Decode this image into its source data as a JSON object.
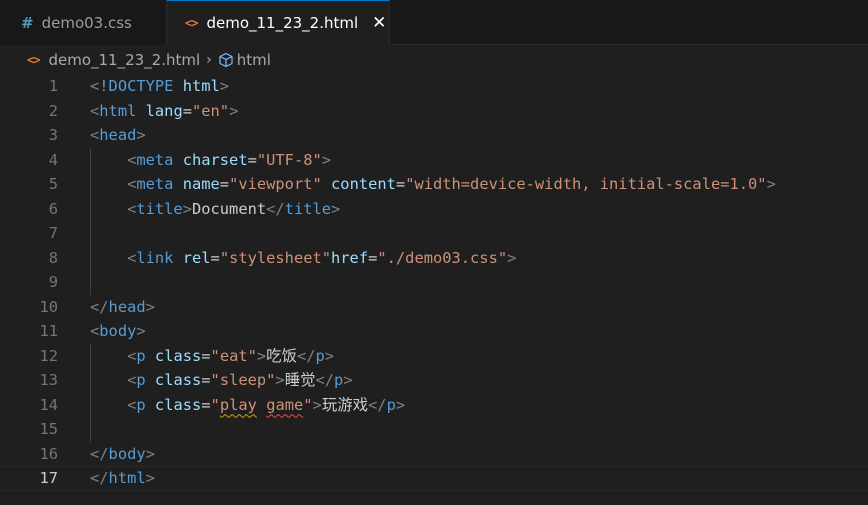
{
  "tabs": [
    {
      "label": "demo03.css",
      "icon": "css-hash-icon",
      "active": false
    },
    {
      "label": "demo_11_23_2.html",
      "icon": "html-icon",
      "active": true
    }
  ],
  "tab_close_glyph": "✕",
  "breadcrumb": {
    "file": "demo_11_23_2.html",
    "separator": "›",
    "symbol": "html"
  },
  "colors": {
    "tag": "#569cd6",
    "bracket": "#808080",
    "attribute": "#9cdcfe",
    "string": "#ce9178",
    "text": "#cccccc",
    "accent": "#0078d4",
    "warning_squiggle": "#cca700",
    "error_squiggle": "#f14c4c"
  },
  "editor": {
    "current_line": 17,
    "lines": [
      {
        "n": "1",
        "tokens": [
          [
            "b",
            "<"
          ],
          [
            "t",
            "!DOCTYPE"
          ],
          [
            "x",
            " "
          ],
          [
            "a",
            "html"
          ],
          [
            "b",
            ">"
          ]
        ]
      },
      {
        "n": "2",
        "tokens": [
          [
            "b",
            "<"
          ],
          [
            "t",
            "html"
          ],
          [
            "x",
            " "
          ],
          [
            "a",
            "lang"
          ],
          [
            "e",
            "="
          ],
          [
            "s",
            "\"en\""
          ],
          [
            "b",
            ">"
          ]
        ]
      },
      {
        "n": "3",
        "tokens": [
          [
            "b",
            "<"
          ],
          [
            "t",
            "head"
          ],
          [
            "b",
            ">"
          ]
        ]
      },
      {
        "n": "4",
        "tokens": [
          [
            "x",
            "    "
          ],
          [
            "b",
            "<"
          ],
          [
            "t",
            "meta"
          ],
          [
            "x",
            " "
          ],
          [
            "a",
            "charset"
          ],
          [
            "e",
            "="
          ],
          [
            "s",
            "\"UTF-8\""
          ],
          [
            "b",
            ">"
          ]
        ]
      },
      {
        "n": "5",
        "tokens": [
          [
            "x",
            "    "
          ],
          [
            "b",
            "<"
          ],
          [
            "t",
            "meta"
          ],
          [
            "x",
            " "
          ],
          [
            "a",
            "name"
          ],
          [
            "e",
            "="
          ],
          [
            "s",
            "\"viewport\""
          ],
          [
            "x",
            " "
          ],
          [
            "a",
            "content"
          ],
          [
            "e",
            "="
          ],
          [
            "s",
            "\"width=device-width, initial-scale=1.0\""
          ],
          [
            "b",
            ">"
          ]
        ]
      },
      {
        "n": "6",
        "tokens": [
          [
            "x",
            "    "
          ],
          [
            "b",
            "<"
          ],
          [
            "t",
            "title"
          ],
          [
            "b",
            ">"
          ],
          [
            "x",
            "Document"
          ],
          [
            "b",
            "</"
          ],
          [
            "t",
            "title"
          ],
          [
            "b",
            ">"
          ]
        ]
      },
      {
        "n": "7",
        "tokens": []
      },
      {
        "n": "8",
        "tokens": [
          [
            "x",
            "    "
          ],
          [
            "b",
            "<"
          ],
          [
            "t",
            "link"
          ],
          [
            "x",
            " "
          ],
          [
            "a",
            "rel"
          ],
          [
            "e",
            "="
          ],
          [
            "s",
            "\"stylesheet\""
          ],
          [
            "a",
            "href"
          ],
          [
            "e",
            "="
          ],
          [
            "s",
            "\"./demo03.css\""
          ],
          [
            "b",
            ">"
          ]
        ]
      },
      {
        "n": "9",
        "tokens": []
      },
      {
        "n": "10",
        "tokens": [
          [
            "b",
            "</"
          ],
          [
            "t",
            "head"
          ],
          [
            "b",
            ">"
          ]
        ]
      },
      {
        "n": "11",
        "tokens": [
          [
            "b",
            "<"
          ],
          [
            "t",
            "body"
          ],
          [
            "b",
            ">"
          ]
        ]
      },
      {
        "n": "12",
        "tokens": [
          [
            "x",
            "    "
          ],
          [
            "b",
            "<"
          ],
          [
            "t",
            "p"
          ],
          [
            "x",
            " "
          ],
          [
            "a",
            "class"
          ],
          [
            "e",
            "="
          ],
          [
            "s",
            "\"eat\""
          ],
          [
            "b",
            ">"
          ],
          [
            "x",
            "吃饭"
          ],
          [
            "b",
            "</"
          ],
          [
            "t",
            "p"
          ],
          [
            "b",
            ">"
          ]
        ]
      },
      {
        "n": "13",
        "tokens": [
          [
            "x",
            "    "
          ],
          [
            "b",
            "<"
          ],
          [
            "t",
            "p"
          ],
          [
            "x",
            " "
          ],
          [
            "a",
            "class"
          ],
          [
            "e",
            "="
          ],
          [
            "s",
            "\"sleep\""
          ],
          [
            "b",
            ">"
          ],
          [
            "x",
            "睡觉"
          ],
          [
            "b",
            "</"
          ],
          [
            "t",
            "p"
          ],
          [
            "b",
            ">"
          ]
        ]
      },
      {
        "n": "14",
        "tokens": [
          [
            "x",
            "    "
          ],
          [
            "b",
            "<"
          ],
          [
            "t",
            "p"
          ],
          [
            "x",
            " "
          ],
          [
            "a",
            "class"
          ],
          [
            "e",
            "="
          ],
          [
            "s",
            "\""
          ],
          [
            "sy",
            "play"
          ],
          [
            "s",
            " "
          ],
          [
            "sr",
            "game"
          ],
          [
            "s",
            "\""
          ],
          [
            "b",
            ">"
          ],
          [
            "x",
            "玩游戏"
          ],
          [
            "b",
            "</"
          ],
          [
            "t",
            "p"
          ],
          [
            "b",
            ">"
          ]
        ]
      },
      {
        "n": "15",
        "tokens": []
      },
      {
        "n": "16",
        "tokens": [
          [
            "b",
            "</"
          ],
          [
            "t",
            "body"
          ],
          [
            "b",
            ">"
          ]
        ]
      },
      {
        "n": "17",
        "tokens": [
          [
            "b",
            "</"
          ],
          [
            "t",
            "html"
          ],
          [
            "b",
            ">"
          ]
        ]
      }
    ]
  }
}
